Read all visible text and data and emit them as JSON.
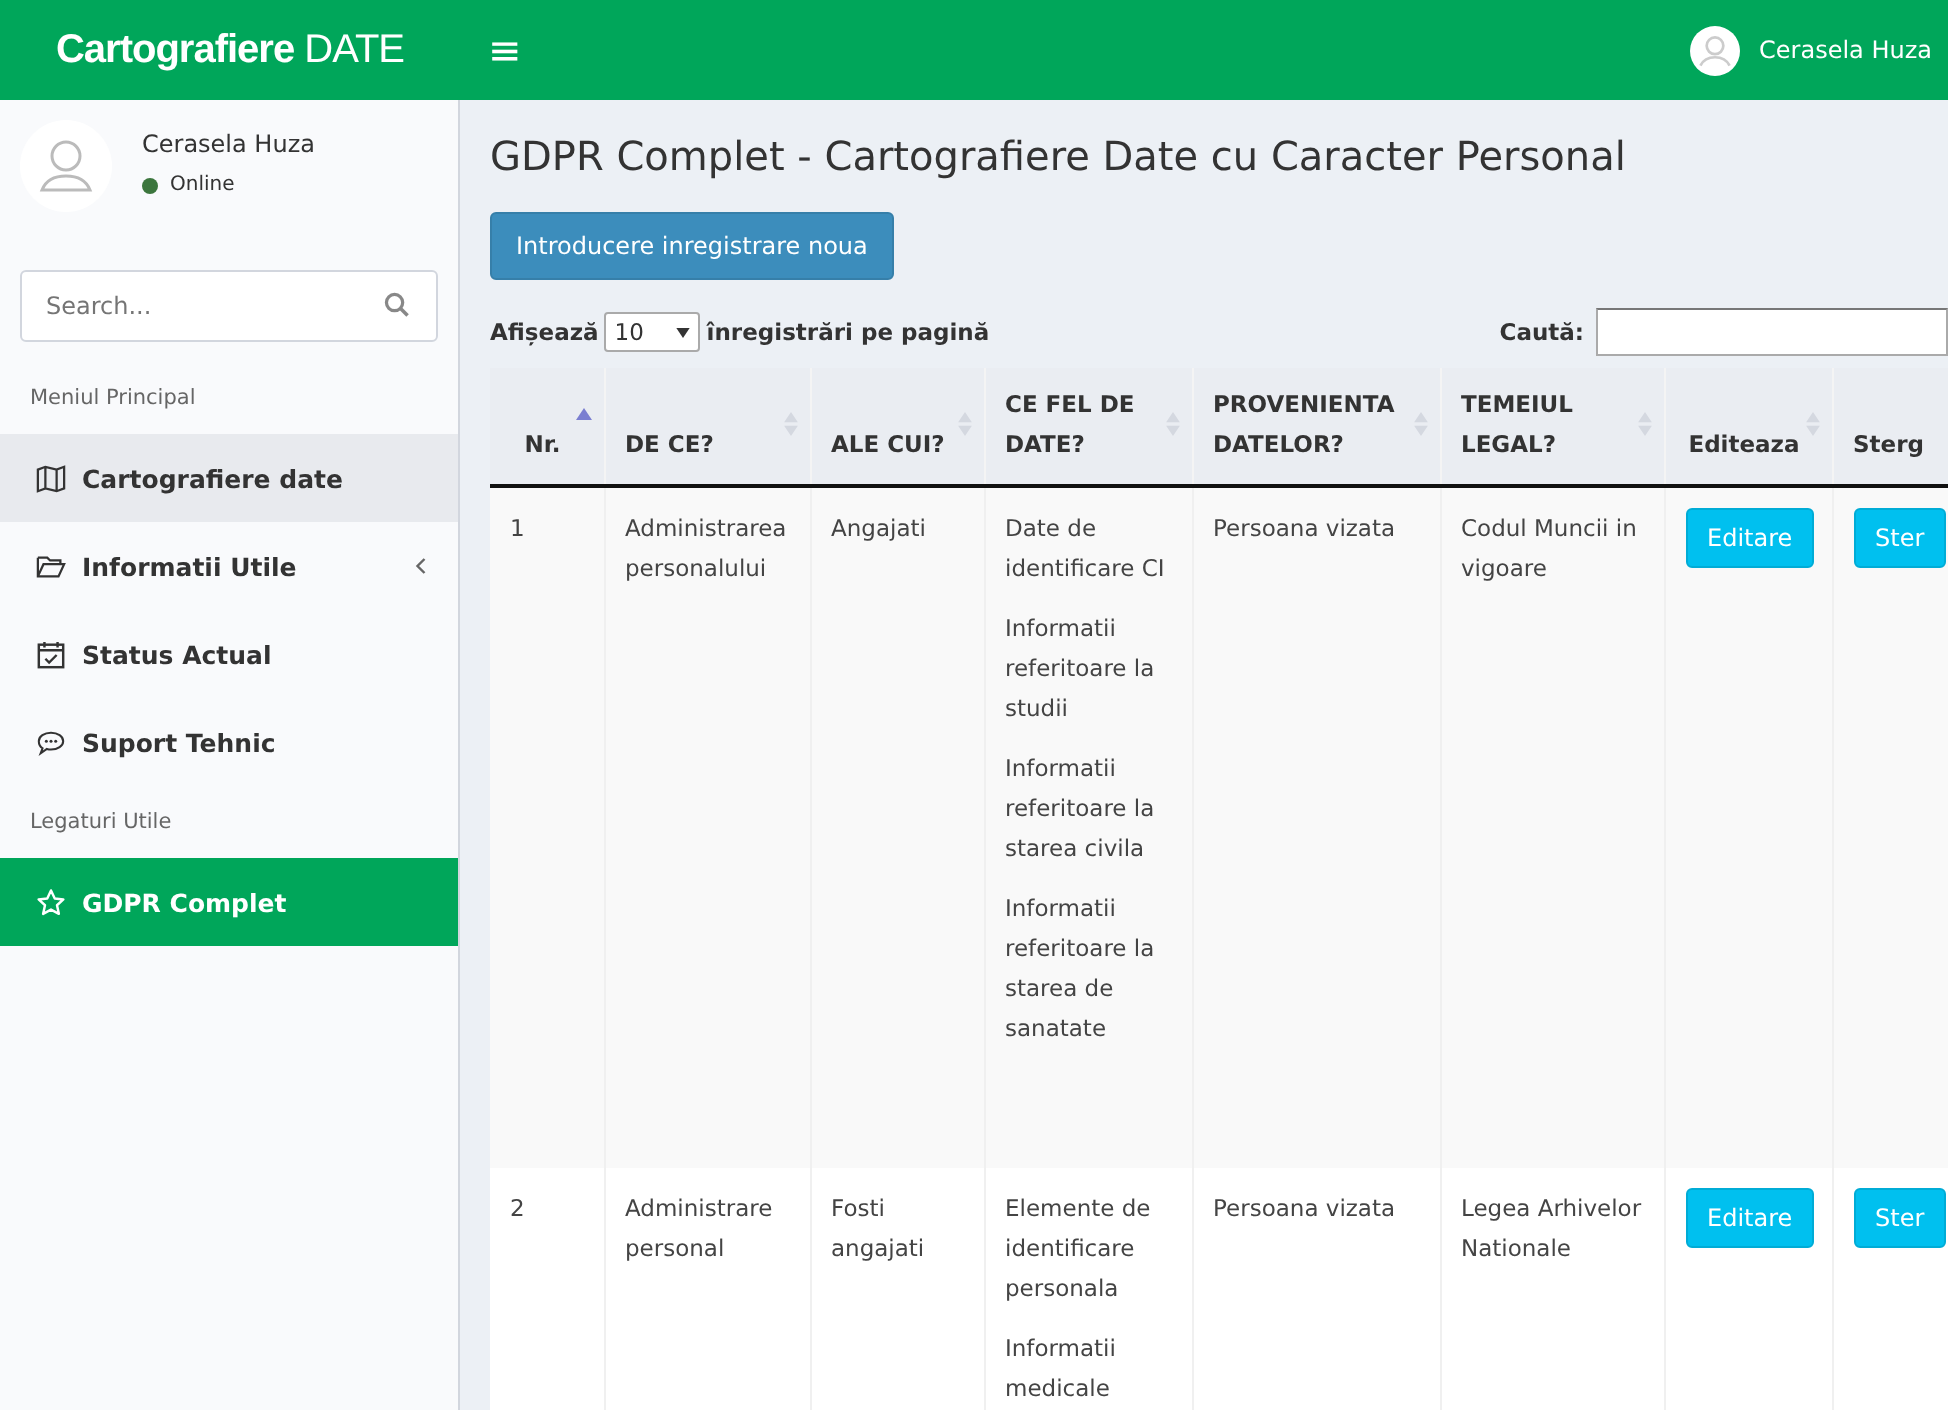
{
  "header": {
    "logo_bold": "Cartografiere",
    "logo_light": "DATE",
    "menu_toggle": "≡",
    "user_name": "Cerasela Huza"
  },
  "sidebar": {
    "user": {
      "name": "Cerasela Huza",
      "status": "Online"
    },
    "search": {
      "placeholder": "Search..."
    },
    "sections": [
      {
        "header": "Meniul Principal",
        "items": [
          {
            "label": "Cartografiere date",
            "selected": false,
            "hovered": true
          },
          {
            "label": "Informatii Utile",
            "selected": false,
            "hovered": false,
            "expanded": false
          },
          {
            "label": "Status Actual",
            "selected": false,
            "hovered": false
          },
          {
            "label": "Suport Tehnic",
            "selected": false,
            "hovered": false
          }
        ]
      },
      {
        "header": "Legaturi Utile",
        "items": [
          {
            "label": "GDPR Complet",
            "selected": true,
            "hovered": false
          }
        ]
      }
    ]
  },
  "page": {
    "title": "GDPR Complet - Cartografiere Date cu Caracter Personal",
    "new_button": "Introducere inregistrare noua",
    "length": {
      "before": "Afișează",
      "value": "10",
      "after": "înregistrări pe pagină"
    },
    "search": {
      "label": "Caută:"
    }
  },
  "table": {
    "columns": [
      {
        "label": "Nr.",
        "sortable": true,
        "sorted": true
      },
      {
        "label": "DE CE?",
        "sortable": true,
        "sorted": false
      },
      {
        "label": "ALE CUI?",
        "sortable": true,
        "sorted": false
      },
      {
        "label": "CE FEL DE DATE?",
        "sortable": true,
        "sorted": false
      },
      {
        "label": "PROVENIENTA DATELOR?",
        "sortable": true,
        "sorted": false
      },
      {
        "label": "TEMEIUL LEGAL?",
        "sortable": true,
        "sorted": false
      },
      {
        "label": "Editeaza",
        "sortable": true,
        "sorted": false
      },
      {
        "label": "Sterg",
        "sortable": false,
        "sorted": false
      }
    ],
    "rows": [
      {
        "nr": "1",
        "de_ce": "Administrarea personalului",
        "ale_cui": "Angajati",
        "ce_fel": [
          "Date de identificare CI",
          "Informatii referitoare la studii",
          "Informatii referitoare la starea civila",
          "Informatii referitoare la starea de sanatate"
        ],
        "provenienta": "Persoana vizata",
        "temeiul": "Codul Muncii in vigoare",
        "edit": "Editare",
        "delete": "Ster"
      },
      {
        "nr": "2",
        "de_ce": "Administrare personal",
        "ale_cui": "Fosti angajati",
        "ce_fel": [
          "Elemente de identificare personala",
          "Informatii medicale"
        ],
        "provenienta": "Persoana vizata",
        "temeiul": "Legea Arhivelor Nationale",
        "edit": "Editare",
        "delete": "Ster"
      }
    ]
  }
}
